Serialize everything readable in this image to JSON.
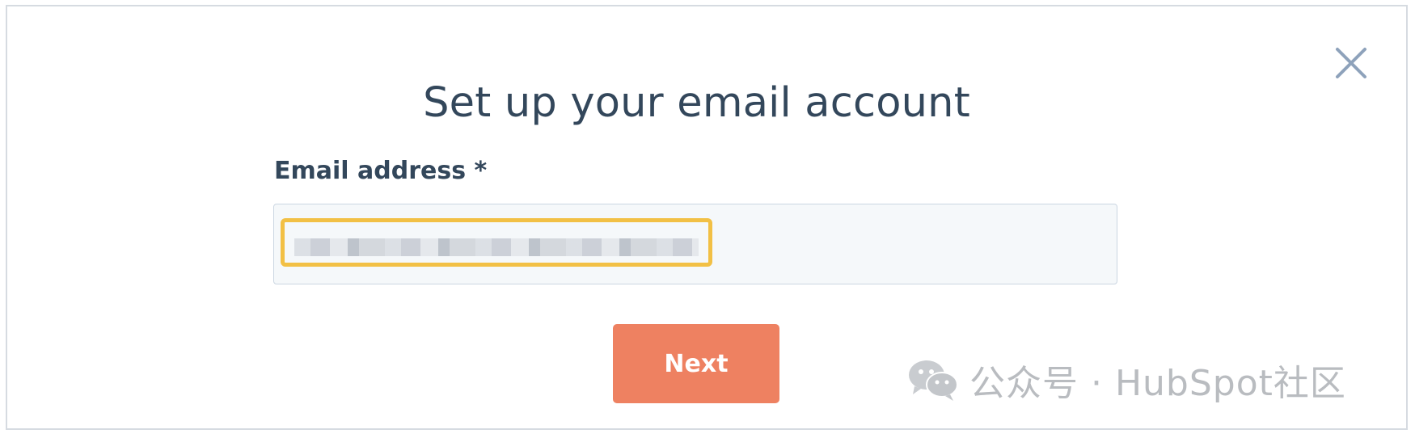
{
  "dialog": {
    "title": "Set up your email account",
    "close_icon": "close-icon"
  },
  "form": {
    "email_label": "Email address *",
    "email_value_state": "redacted"
  },
  "actions": {
    "next_label": "Next"
  },
  "watermark": {
    "icon": "wechat-icon",
    "text": "公众号 · HubSpot社区"
  },
  "colors": {
    "title_text": "#33475b",
    "input_background": "#f5f8fa",
    "input_border": "#cbd6e2",
    "highlight_border": "#f2c045",
    "next_button": "#ee8161",
    "close_icon": "#8ea2bb",
    "watermark_text": "#b9bcc0"
  }
}
